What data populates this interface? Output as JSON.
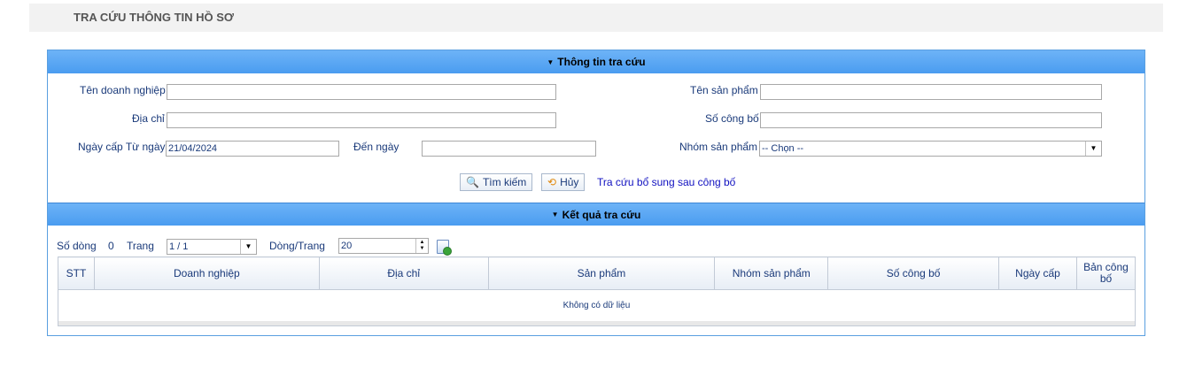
{
  "header": {
    "title": "TRA CỨU THÔNG TIN HỒ SƠ"
  },
  "search_panel": {
    "title": "Thông tin tra cứu",
    "company_label": "Tên doanh nghiệp",
    "company_value": "",
    "address_label": "Địa chỉ",
    "address_value": "",
    "date_from_label": "Ngày cấp Từ ngày",
    "date_from_value": "21/04/2024",
    "date_to_label": "Đến ngày",
    "date_to_value": "",
    "product_label": "Tên sản phẩm",
    "product_value": "",
    "announce_label": "Số công bố",
    "announce_value": "",
    "group_label": "Nhóm sản phẩm",
    "group_selected": "-- Chọn --",
    "search_button": "Tìm kiếm",
    "cancel_button": "Hủy",
    "supplement_link": "Tra cứu bổ sung sau công bố"
  },
  "results_panel": {
    "title": "Kết quả tra cứu",
    "rows_label": "Số dòng",
    "rows_count": "0",
    "page_label": "Trang",
    "page_value": "1 / 1",
    "per_page_label": "Dòng/Trang",
    "per_page_value": "20",
    "columns": [
      "STT",
      "Doanh nghiệp",
      "Địa chỉ",
      "Sản phẩm",
      "Nhóm sản phẩm",
      "Số công bố",
      "Ngày cấp",
      "Bản công bố"
    ],
    "empty_message": "Không có dữ liệu"
  },
  "icons": {
    "collapse": "triangle-down-icon",
    "search": "magnifier-icon",
    "cancel": "refresh-icon",
    "export": "export-document-icon"
  }
}
